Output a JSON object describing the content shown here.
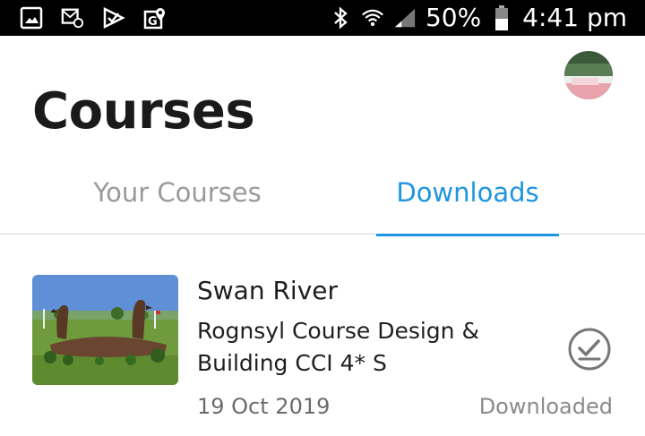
{
  "status_bar": {
    "battery": "50%",
    "time": "4:41 pm",
    "icons": [
      "image-icon",
      "email-notification-icon",
      "store-icon",
      "maps-icon",
      "bluetooth-icon",
      "wifi-icon",
      "signal-icon",
      "battery-icon"
    ]
  },
  "header": {
    "title": "Courses",
    "avatar": "avatar"
  },
  "tabs": [
    {
      "label": "Your Courses",
      "active": false
    },
    {
      "label": "Downloads",
      "active": true
    }
  ],
  "colors": {
    "accent": "#1e95e0",
    "inactive_tab": "#9a9a9a",
    "title": "#1a1a1a"
  },
  "courses": [
    {
      "name": "Swan River",
      "subtitle": "Rognsyl Course Design & Building CCI 4* S",
      "date": "19 Oct 2019",
      "status": "Downloaded",
      "status_icon": "check-circle-icon"
    }
  ]
}
